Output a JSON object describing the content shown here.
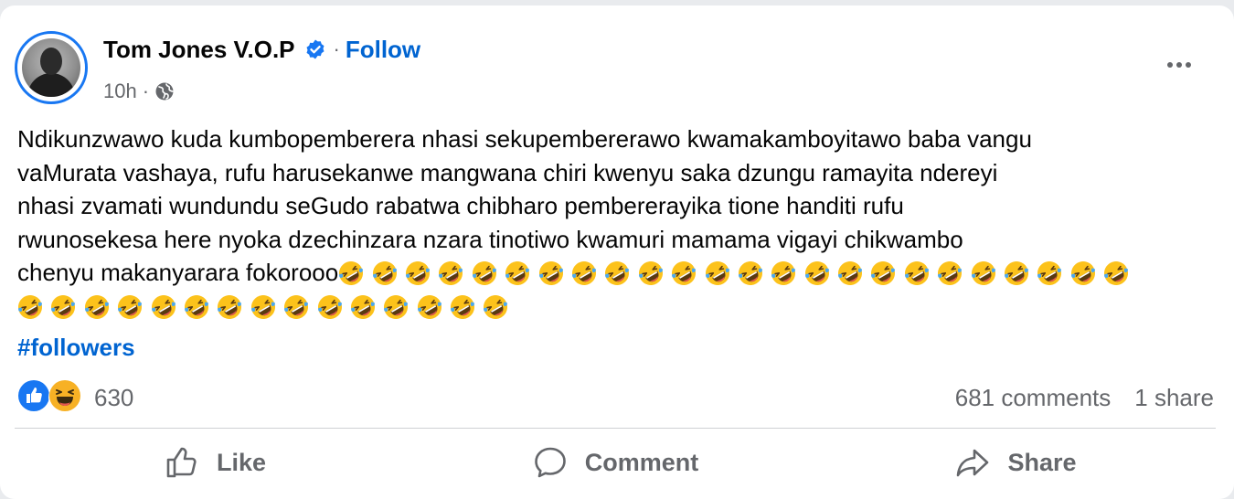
{
  "post": {
    "author": "Tom Jones V.O.P",
    "follow_label": "Follow",
    "separator": "·",
    "timestamp": "10h",
    "text_lines": [
      "Ndikunzwawo kuda kumbopemberera nhasi sekupembererawo kwamakamboyitawo baba vangu",
      "vaMurata vashaya, rufu harusekanwe mangwana chiri kwenyu saka dzungu ramayita ndereyi",
      "nhasi zvamati wundundu seGudo rabatwa chibharo pembererayika tione handiti rufu",
      "rwunosekesa here nyoka dzechinzara nzara tinotiwo kwamuri mamama vigayi chikwambo",
      "chenyu makanyarara fokorooo"
    ],
    "emoji": {
      "name": "rolling-on-floor-laughing",
      "count_line5": 24,
      "count_line6": 15
    },
    "hashtag": "#followers",
    "reaction_count": "630",
    "comments": "681 comments",
    "shares": "1 share"
  },
  "actions": {
    "like": "Like",
    "comment": "Comment",
    "share": "Share"
  },
  "icons": {
    "verified": "verified-badge-icon",
    "globe": "globe-icon",
    "more": "more-horizontal-icon",
    "like": "thumbs-up-icon",
    "comment": "comment-bubble-icon",
    "share": "share-arrow-icon"
  },
  "colors": {
    "accent": "#0064d1",
    "secondary_text": "#65676b",
    "like_reaction": "#1877f2",
    "haha_reaction": "#f7b125"
  }
}
